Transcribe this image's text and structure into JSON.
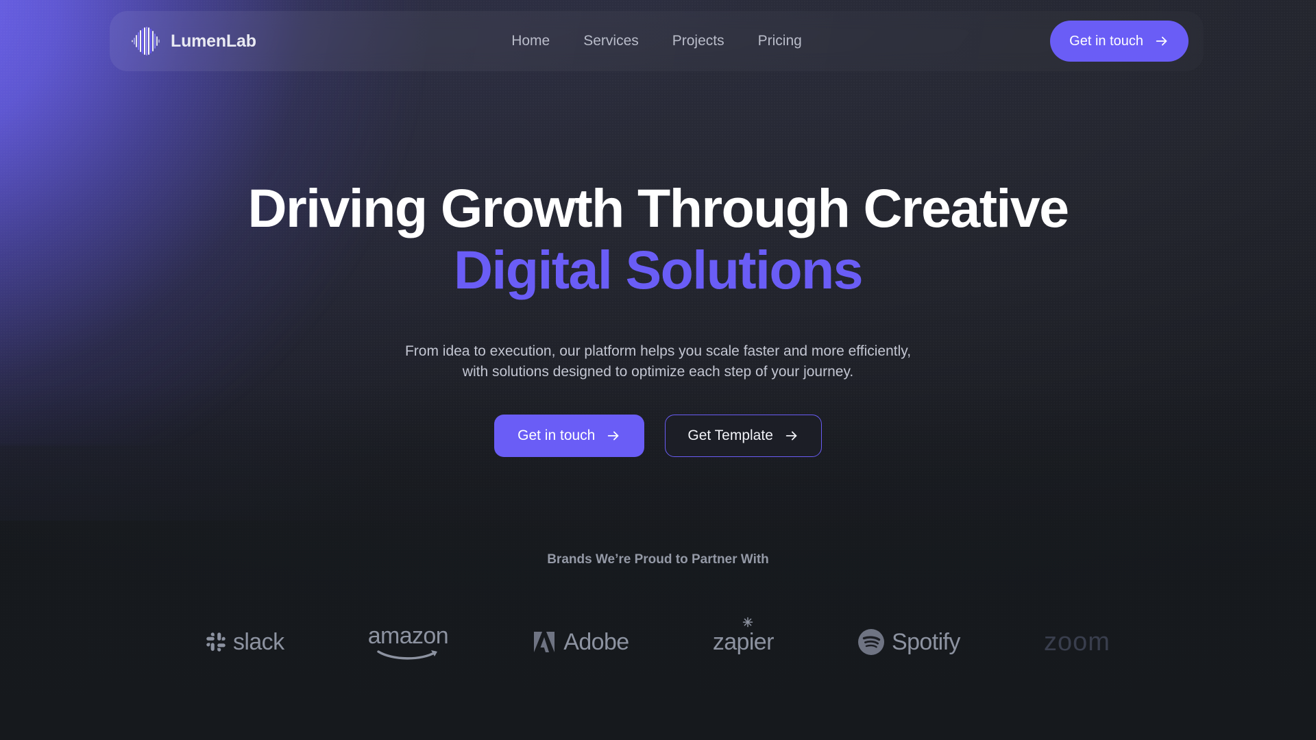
{
  "header": {
    "brand_name": "LumenLab",
    "logo_icon": "waveform-logo-icon",
    "nav": [
      {
        "label": "Home"
      },
      {
        "label": "Services"
      },
      {
        "label": "Projects"
      },
      {
        "label": "Pricing"
      }
    ],
    "cta_label": "Get in touch",
    "cta_icon": "arrow-right-icon"
  },
  "hero": {
    "headline_line1": "Driving Growth Through Creative",
    "headline_line2": "Digital Solutions",
    "subtitle_line1": "From idea to execution, our platform helps you scale faster and more efficiently,",
    "subtitle_line2": "with solutions designed to optimize each step of your journey.",
    "primary_cta": "Get in touch",
    "secondary_cta": "Get Template",
    "cta_icon": "arrow-right-icon"
  },
  "partners": {
    "label": "Brands We’re Proud to Partner With",
    "logos": [
      {
        "name": "slack",
        "word": "slack",
        "icon": "slack-icon"
      },
      {
        "name": "amazon",
        "word": "amazon",
        "icon": "amazon-smile-icon"
      },
      {
        "name": "adobe",
        "word": "Adobe",
        "icon": "adobe-a-icon"
      },
      {
        "name": "zapier",
        "word": "zapier",
        "icon": "zapier-asterisk-icon"
      },
      {
        "name": "spotify",
        "word": "Spotify",
        "icon": "spotify-icon"
      },
      {
        "name": "zoom",
        "word": "zoom",
        "icon": "zoom-wordmark-icon"
      }
    ]
  },
  "colors": {
    "accent": "#6a5df6",
    "background": "#16191d",
    "headline": "#ffffff",
    "muted_text": "#c3c6d2",
    "logo_gray": "#8d93a1"
  }
}
